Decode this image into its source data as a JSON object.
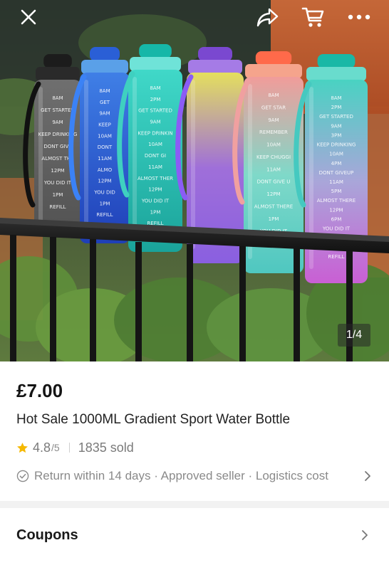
{
  "hero": {
    "image_counter": "1/4",
    "bottles": [
      {
        "colors": [
          "#6f6f6f",
          "#525252"
        ],
        "markings": [
          "8AM",
          "GET STARTED",
          "9AM",
          "KEEP DRINKING",
          "DONT GIVE",
          "ALMOST THE",
          "12PM",
          "YOU DID IT",
          "1PM",
          "REFILL"
        ]
      },
      {
        "colors": [
          "#3f7fe6",
          "#1f3fb8"
        ],
        "markings": [
          "8AM",
          "GET",
          "9AM",
          "KEEP",
          "10AM",
          "DONT",
          "11AM",
          "ALMO",
          "12PM",
          "YOU DID",
          "1PM",
          "REFILL"
        ]
      },
      {
        "colors": [
          "#40d8c8",
          "#1aa39a"
        ],
        "markings": [
          "8AM",
          "2PM",
          "GET STARTED",
          "9AM",
          "KEEP DRINKIN",
          "10AM",
          "DONT GI",
          "11AM",
          "ALMOST THER",
          "12PM",
          "YOU DID IT",
          "1PM",
          "REFILL"
        ]
      },
      {
        "colors": [
          "#e4df5e",
          "#9f6fd9",
          "#8a5fe0"
        ],
        "markings": []
      },
      {
        "colors": [
          "#f19c9a",
          "#7fd9c9",
          "#4fc7c0"
        ],
        "markings": [
          "8AM",
          "GET STAR",
          "9AM",
          "REMEMBER",
          "10AM",
          "KEEP CHUGGI",
          "11AM",
          "DONT GIVE U",
          "12PM",
          "ALMOST THERE",
          "1PM",
          "YOU DID IT",
          "REFILL"
        ]
      },
      {
        "colors": [
          "#49d2c2",
          "#a9a6d9",
          "#c95fd4"
        ],
        "markings": [
          "8AM",
          "2PM",
          "GET STARTED",
          "9AM",
          "3PM",
          "KEEP DRINKING",
          "10AM",
          "4PM",
          "DONT GIVEUP",
          "11AM",
          "5PM",
          "ALMOST THERE",
          "12PM",
          "6PM",
          "YOU DID IT",
          "1PM",
          "7PM",
          "REFILL"
        ]
      }
    ]
  },
  "topbar": {
    "icons": [
      "close-icon",
      "share-icon",
      "cart-icon",
      "more-icon"
    ]
  },
  "product": {
    "price": "£7.00",
    "title": "Hot Sale 1000ML Gradient Sport Water Bottle",
    "rating": "4.8",
    "rating_max": "/5",
    "sold": "1835 sold",
    "service": "Return within 14 days · Approved seller · Logistics cost"
  },
  "coupons": {
    "label": "Coupons"
  },
  "colors": {
    "text_primary": "#1a1a1a",
    "text_secondary": "#8a8a8a",
    "star": "#f5b800",
    "divider_bg": "#f2f2f2"
  }
}
